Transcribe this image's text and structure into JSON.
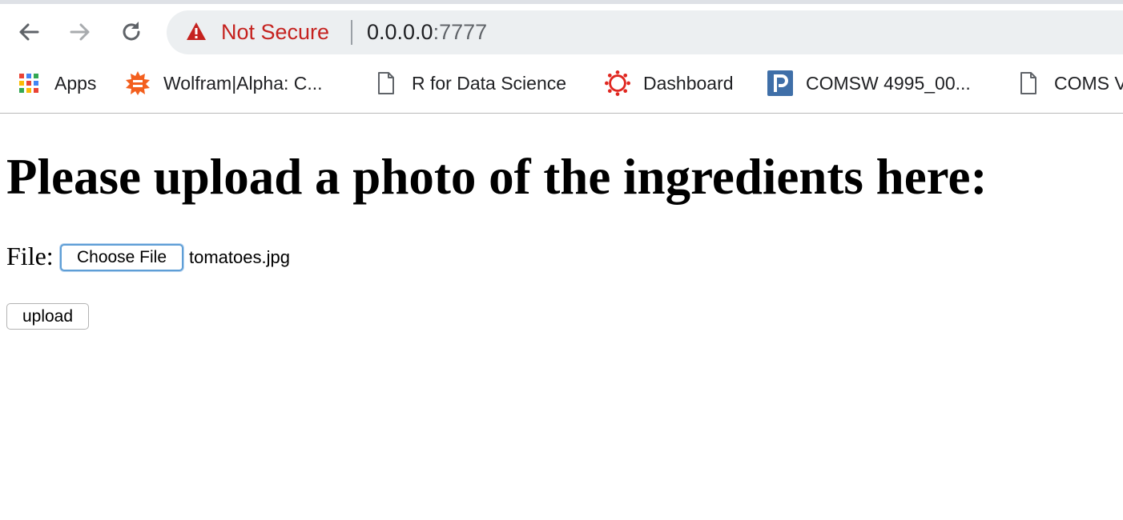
{
  "browser": {
    "security_status": "Not Secure",
    "url_host": "0.0.0.0",
    "url_port": ":7777",
    "bookmarks": [
      {
        "label": "Apps",
        "icon": "apps-grid-icon"
      },
      {
        "label": "Wolfram|Alpha: C...",
        "icon": "wolfram-icon"
      },
      {
        "label": "R for Data Science",
        "icon": "page-icon"
      },
      {
        "label": "Dashboard",
        "icon": "canvas-icon"
      },
      {
        "label": "COMSW 4995_00...",
        "icon": "piazza-icon"
      },
      {
        "label": "COMS V",
        "icon": "page-icon"
      }
    ],
    "colors": {
      "not_secure": "#c5221f",
      "omnibox_bg": "#eceff1",
      "wolfram": "#f35f1e",
      "canvas": "#e0261f",
      "piazza": "#3f6fa8"
    }
  },
  "page": {
    "title": "Please upload a photo of the ingredients here:",
    "file_label": "File:",
    "choose_button": "Choose File",
    "selected_file": "tomatoes.jpg",
    "upload_button": "upload"
  }
}
